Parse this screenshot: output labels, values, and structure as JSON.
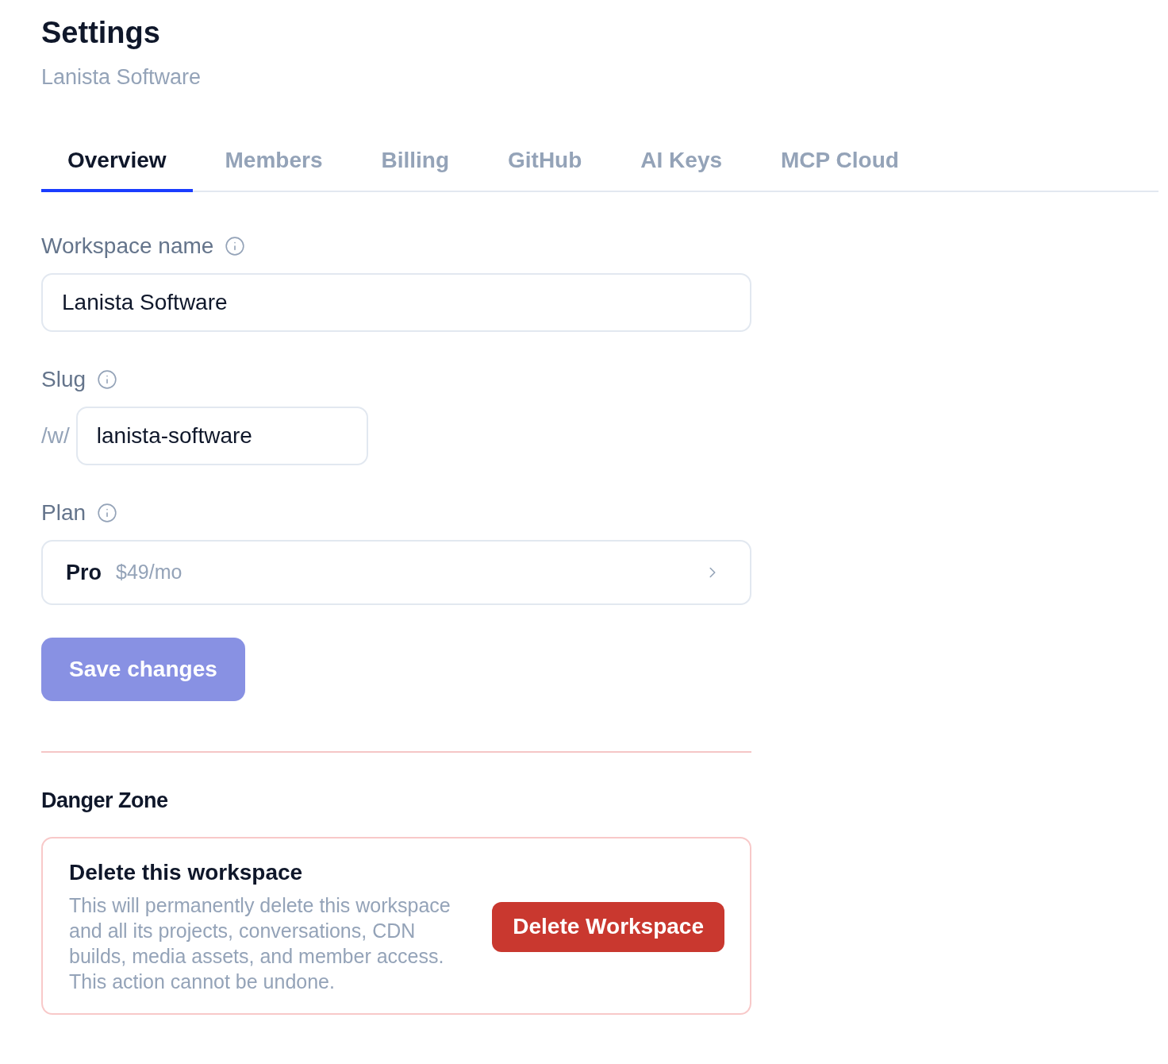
{
  "header": {
    "title": "Settings",
    "subtitle": "Lanista Software"
  },
  "tabs": [
    {
      "label": "Overview",
      "selected": true
    },
    {
      "label": "Members",
      "selected": false
    },
    {
      "label": "Billing",
      "selected": false
    },
    {
      "label": "GitHub",
      "selected": false
    },
    {
      "label": "AI Keys",
      "selected": false
    },
    {
      "label": "MCP Cloud",
      "selected": false
    }
  ],
  "fields": [
    {
      "kind": "text",
      "label": "Workspace name",
      "value": "Lanista Software"
    },
    {
      "kind": "slug",
      "label": "Slug",
      "prefix": "/w/",
      "value": "lanista-software"
    },
    {
      "kind": "select",
      "label": "Plan",
      "value": "Pro",
      "detail": "$49/mo"
    }
  ],
  "save_button": {
    "label": "Save changes",
    "disabled": true
  },
  "danger_zone": {
    "title": "Danger Zone",
    "card": {
      "title": "Delete this workspace",
      "description": "This will permanently delete this workspace and all its projects, conversations, CDN builds, media assets, and member access. This action cannot be undone.",
      "button": "Delete Workspace"
    }
  }
}
